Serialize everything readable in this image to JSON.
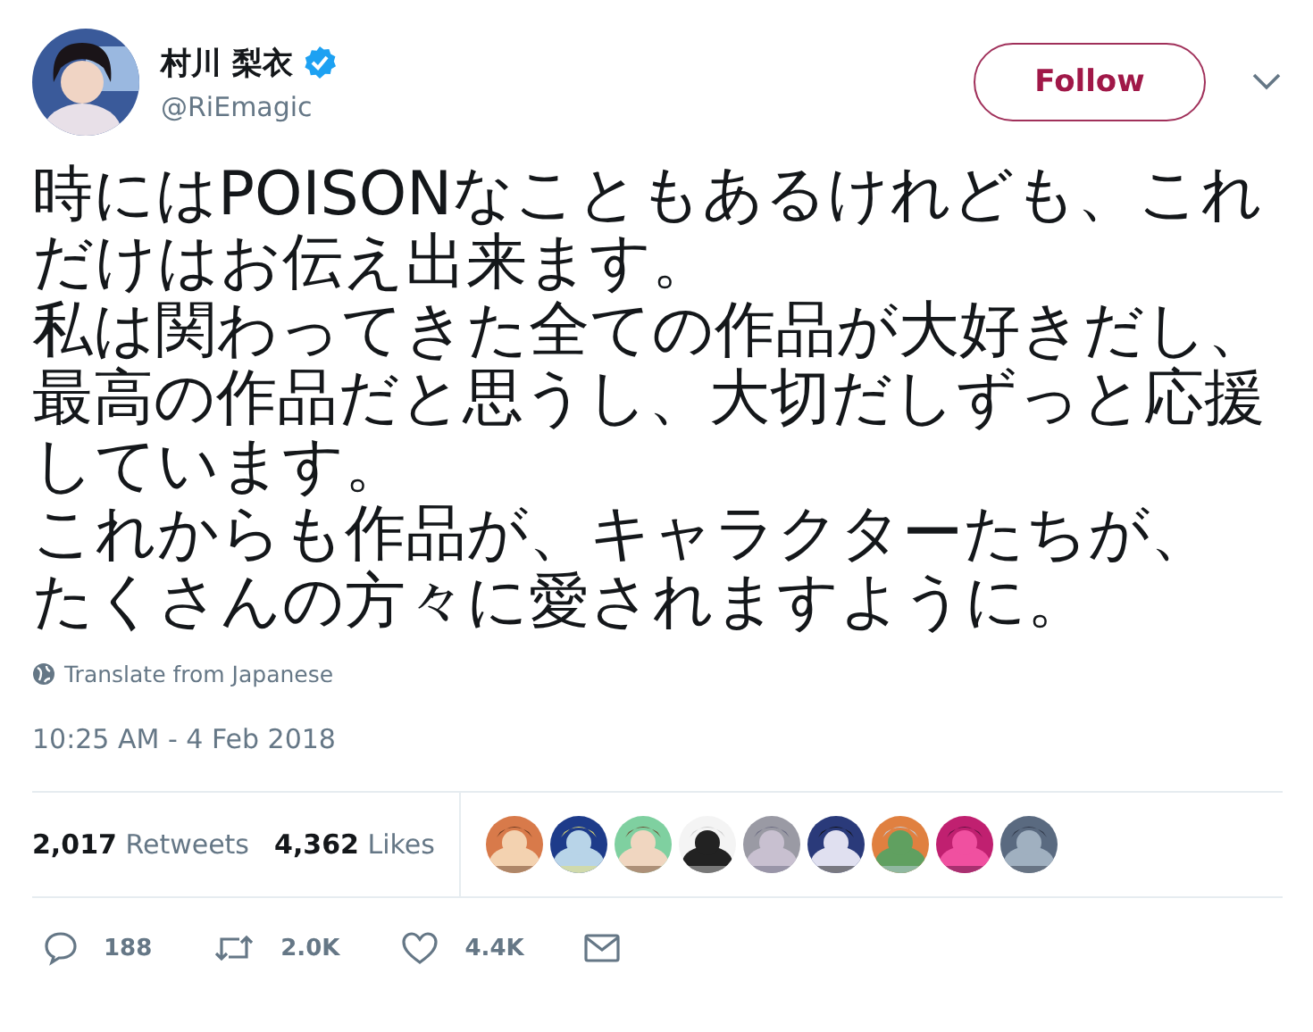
{
  "author": {
    "name": "村川 梨衣",
    "verified": true,
    "handle": "@RiEmagic",
    "avatar": {
      "kind": "picture"
    }
  },
  "follow_button": {
    "label": "Follow"
  },
  "menu_caret": {
    "kind": "caret"
  },
  "tweet_text": [
    "時にはPOISONなこともあるけれども、これだけはお伝え出来ます。",
    "私は関わってきた全ての作品が大好きだし、最高の作品だと思うし、大切だしずっと応援しています。",
    "これからも作品が、キャラクターたちが、たくさんの方々に愛されますように。"
  ],
  "translate_link": "Translate from Japanese",
  "timestamp": "10:25 AM - 4 Feb 2018",
  "stats": [
    {
      "count": "2,017",
      "label": "Retweets"
    },
    {
      "count": "4,362",
      "label": "Likes"
    }
  ],
  "liker_avatars": [
    {
      "kind": "picture"
    },
    {
      "kind": "picture"
    },
    {
      "kind": "picture"
    },
    {
      "kind": "picture"
    },
    {
      "kind": "picture"
    },
    {
      "kind": "picture"
    },
    {
      "kind": "picture"
    },
    {
      "kind": "picture"
    },
    {
      "kind": "picture"
    }
  ],
  "actions": [
    {
      "kind": "reply",
      "count": "188"
    },
    {
      "kind": "retweet",
      "count": "2.0K"
    },
    {
      "kind": "like",
      "count": "4.4K"
    },
    {
      "kind": "message"
    }
  ]
}
